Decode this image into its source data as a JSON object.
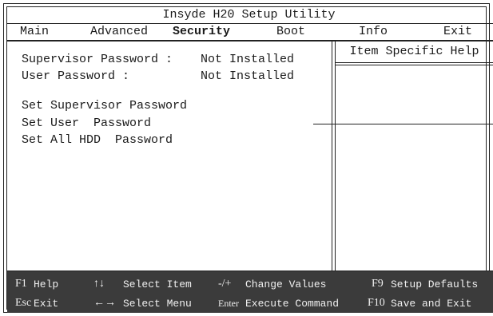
{
  "title": "Insyde H20 Setup Utility",
  "menu": {
    "main": "Main",
    "advanced": "Advanced",
    "security": "Security",
    "boot": "Boot",
    "info": "Info",
    "exit": "Exit"
  },
  "status": {
    "supervisor_label": "Supervisor Password :",
    "supervisor_value": "Not Installed",
    "user_label": "User Password :",
    "user_value": "Not Installed"
  },
  "items": {
    "set_supervisor": "Set Supervisor Password",
    "set_user": "Set User  Password",
    "set_all_hdd": "Set All HDD  Password"
  },
  "help": {
    "title": "Item Specific Help"
  },
  "footer": {
    "f1_key": "F1",
    "f1_label": "Help",
    "arrows_key": "↑↓",
    "arrows_label": "Select Item",
    "change_key": "-/+",
    "change_label": "Change Values",
    "f9_key": "F9",
    "f9_label": "Setup Defaults",
    "esc_key": "Esc",
    "esc_label": "Exit",
    "lr_key": "←→",
    "lr_label": "Select Menu",
    "enter_key": "Enter",
    "enter_label": "Execute Command",
    "f10_key": "F10",
    "f10_label": "Save and Exit"
  },
  "colors": {
    "background": "#ffffff",
    "text": "#1a1a1a",
    "footer_bg": "#3b3b3b",
    "footer_text": "#f0f0f0"
  }
}
